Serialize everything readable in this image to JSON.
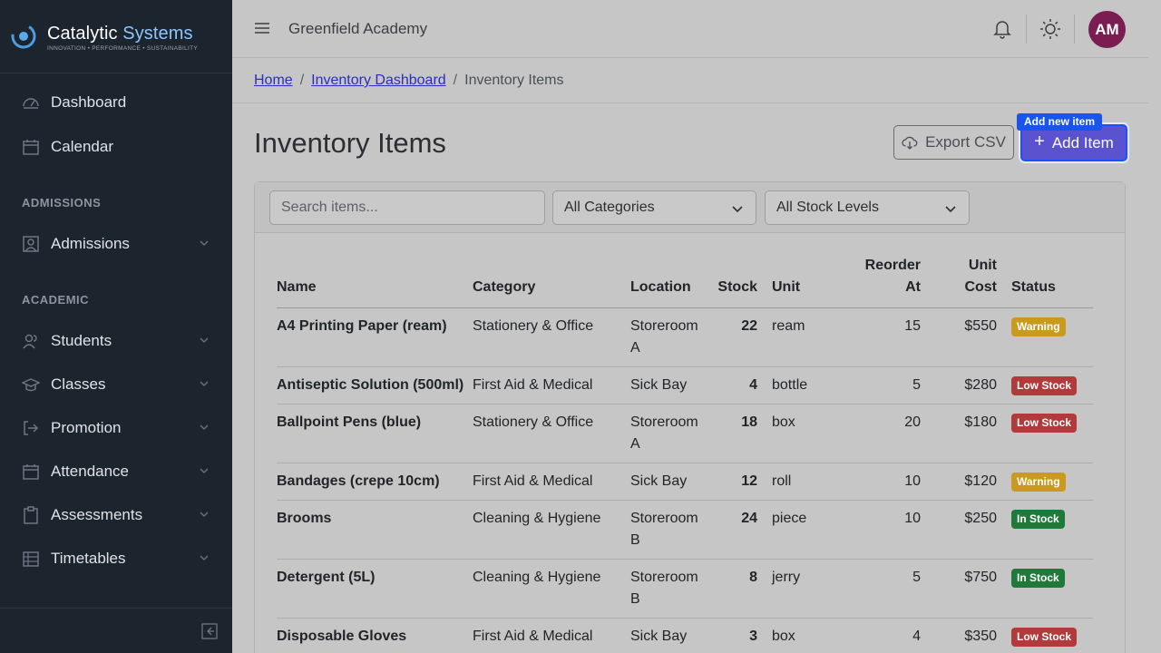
{
  "brand": {
    "name_part1": "Catalytic",
    "name_part2": "Systems",
    "tagline": "INNOVATION • PERFORMANCE • SUSTAINABILITY"
  },
  "sidebar": {
    "items": [
      {
        "label": "Dashboard",
        "icon": "dashboard-icon"
      },
      {
        "label": "Calendar",
        "icon": "calendar-icon"
      }
    ],
    "sections": [
      {
        "title": "ADMISSIONS",
        "items": [
          {
            "label": "Admissions",
            "icon": "admissions-icon"
          }
        ]
      },
      {
        "title": "ACADEMIC",
        "items": [
          {
            "label": "Students",
            "icon": "students-icon"
          },
          {
            "label": "Classes",
            "icon": "classes-icon"
          },
          {
            "label": "Promotion",
            "icon": "promotion-icon"
          },
          {
            "label": "Attendance",
            "icon": "attendance-icon"
          },
          {
            "label": "Assessments",
            "icon": "assessments-icon"
          },
          {
            "label": "Timetables",
            "icon": "timetables-icon"
          }
        ]
      }
    ]
  },
  "header": {
    "school": "Greenfield Academy",
    "avatar_initials": "AM",
    "avatar_color": "#7a1d52"
  },
  "breadcrumb": {
    "home": "Home",
    "parent": "Inventory Dashboard",
    "current": "Inventory Items",
    "separator": "/"
  },
  "page": {
    "title": "Inventory Items",
    "export_label": "Export CSV",
    "add_label": "Add Item",
    "add_tooltip": "Add new item"
  },
  "filters": {
    "search_placeholder": "Search items...",
    "category": "All Categories",
    "stock_level": "All Stock Levels"
  },
  "table": {
    "headers": {
      "name": "Name",
      "category": "Category",
      "location": "Location",
      "stock": "Stock",
      "unit": "Unit",
      "reorder_line1": "Reorder",
      "reorder_line2": "At",
      "cost_line1": "Unit",
      "cost_line2": "Cost",
      "status": "Status"
    },
    "rows": [
      {
        "name": "A4 Printing Paper (ream)",
        "category": "Stationery & Office",
        "location": "Storeroom A",
        "stock": "22",
        "unit": "ream",
        "reorder": "15",
        "cost": "$550",
        "status": "Warning"
      },
      {
        "name": "Antiseptic Solution (500ml)",
        "category": "First Aid & Medical",
        "location": "Sick Bay",
        "stock": "4",
        "unit": "bottle",
        "reorder": "5",
        "cost": "$280",
        "status": "Low Stock"
      },
      {
        "name": "Ballpoint Pens (blue)",
        "category": "Stationery & Office",
        "location": "Storeroom A",
        "stock": "18",
        "unit": "box",
        "reorder": "20",
        "cost": "$180",
        "status": "Low Stock"
      },
      {
        "name": "Bandages (crepe 10cm)",
        "category": "First Aid & Medical",
        "location": "Sick Bay",
        "stock": "12",
        "unit": "roll",
        "reorder": "10",
        "cost": "$120",
        "status": "Warning"
      },
      {
        "name": "Brooms",
        "category": "Cleaning & Hygiene",
        "location": "Storeroom B",
        "stock": "24",
        "unit": "piece",
        "reorder": "10",
        "cost": "$250",
        "status": "In Stock"
      },
      {
        "name": "Detergent (5L)",
        "category": "Cleaning & Hygiene",
        "location": "Storeroom B",
        "stock": "8",
        "unit": "jerry",
        "reorder": "5",
        "cost": "$750",
        "status": "In Stock"
      },
      {
        "name": "Disposable Gloves",
        "category": "First Aid & Medical",
        "location": "Sick Bay",
        "stock": "3",
        "unit": "box",
        "reorder": "4",
        "cost": "$350",
        "status": "Low Stock"
      }
    ]
  },
  "status_colors": {
    "Warning": "#c99a1c",
    "Low Stock": "#b33a3a",
    "In Stock": "#1f7a3a"
  }
}
